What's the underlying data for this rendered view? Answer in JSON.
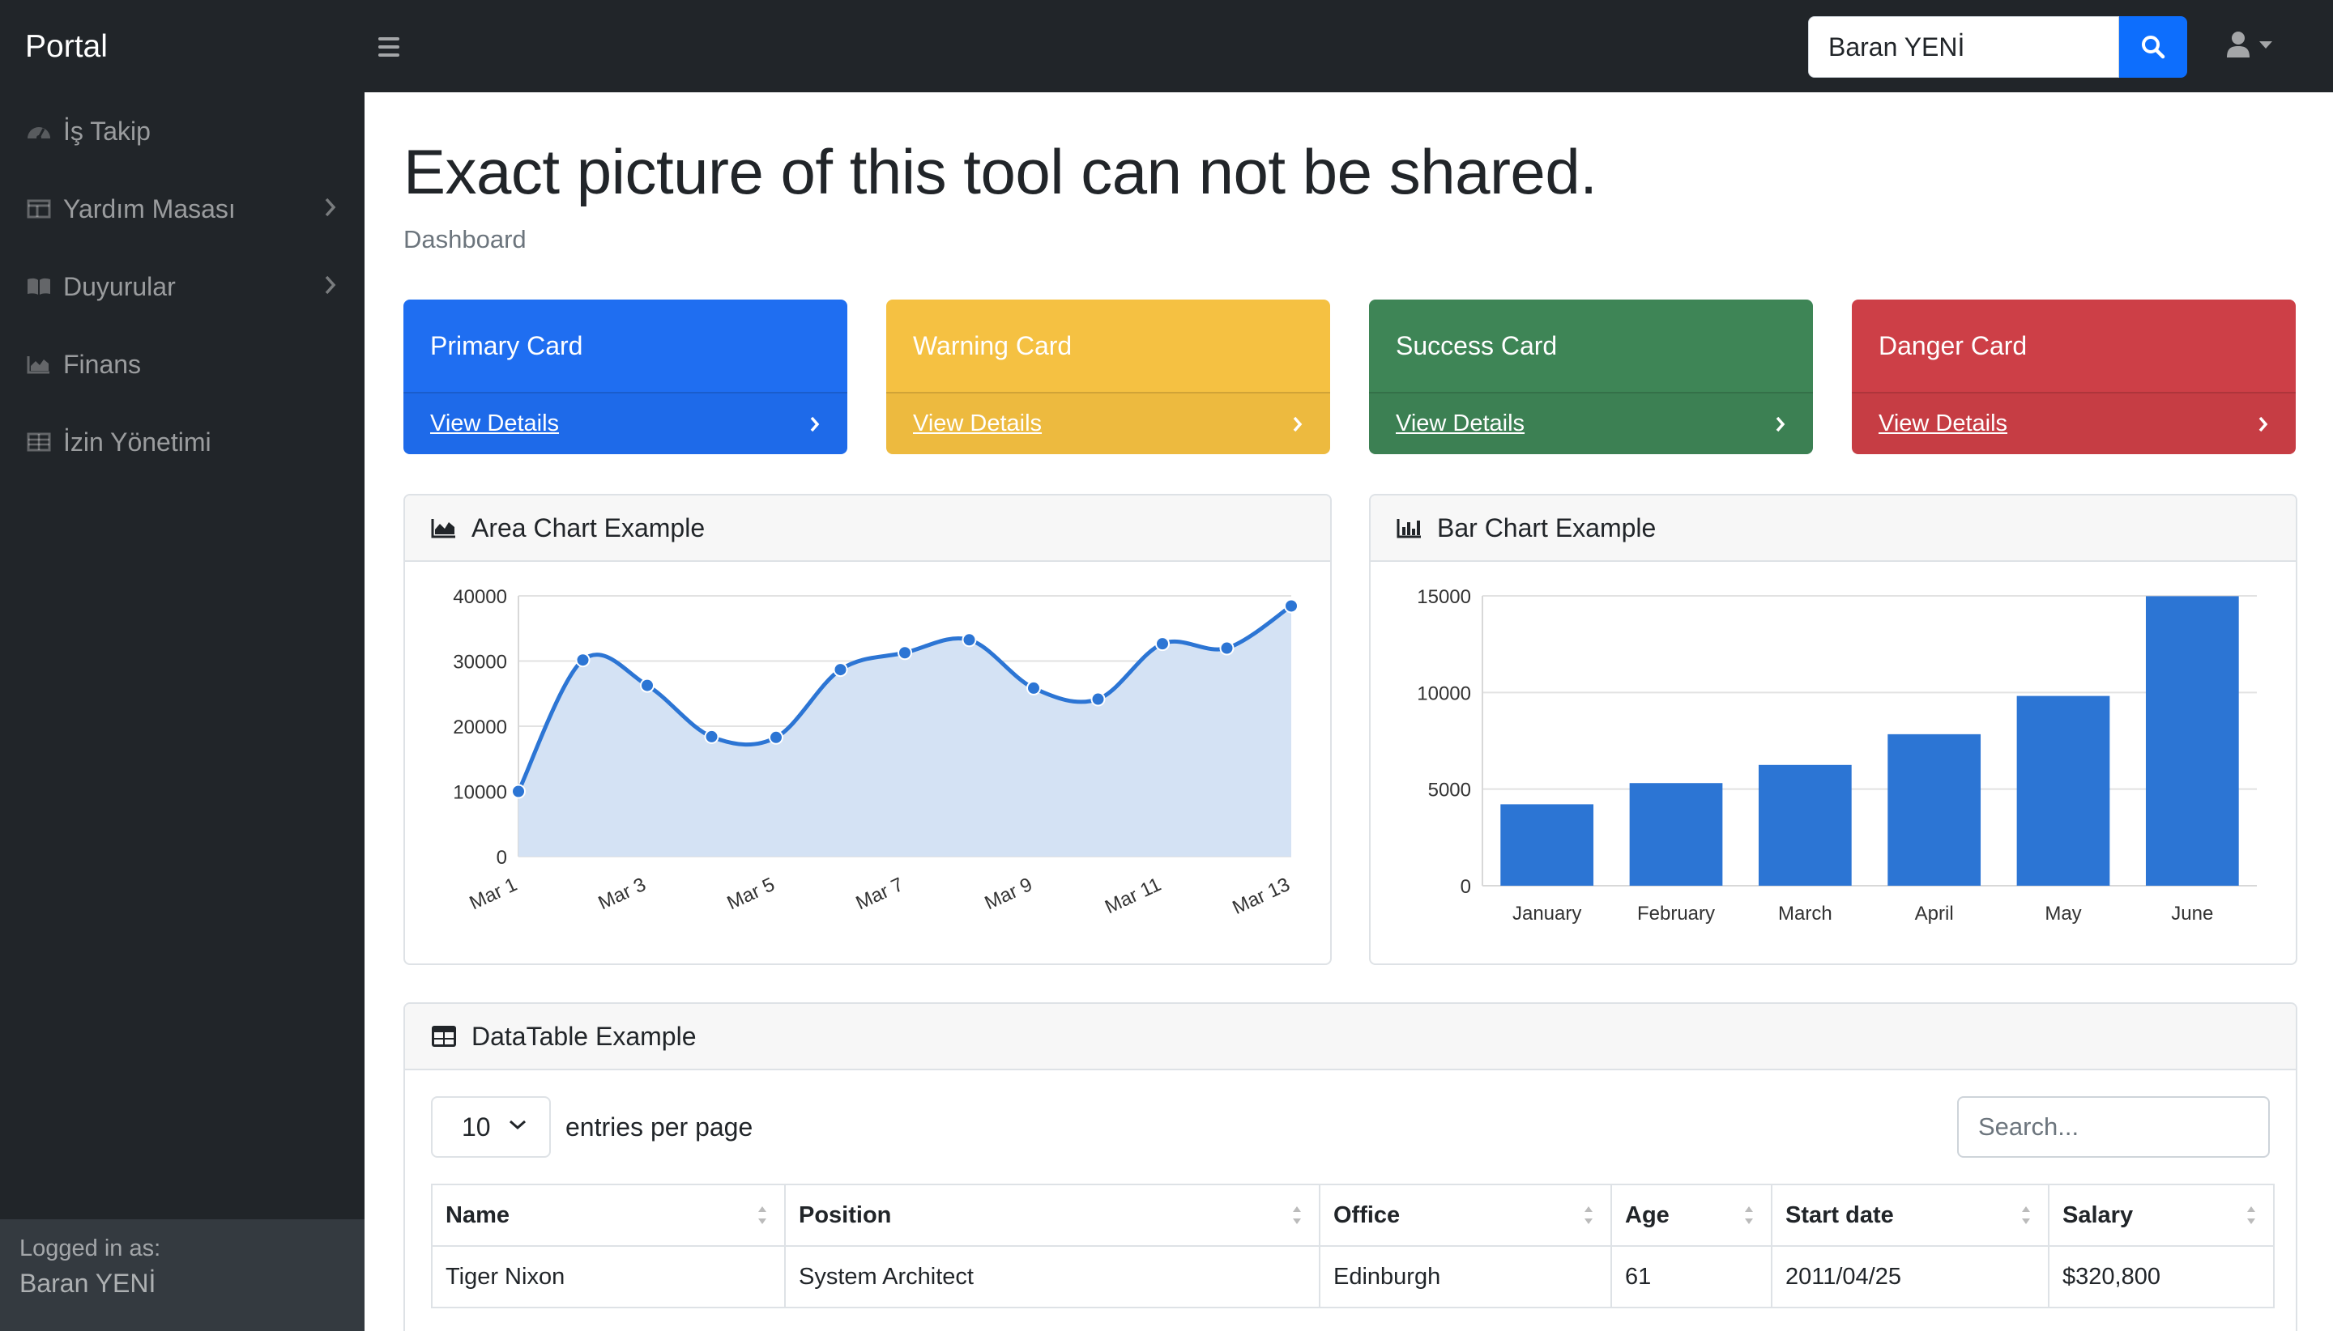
{
  "app": {
    "brand": "Portal"
  },
  "topbar": {
    "search_value": "Baran YENİ"
  },
  "sidebar": {
    "items": [
      {
        "label": "İş Takip",
        "icon": "gauge-icon",
        "has_chevron": false
      },
      {
        "label": "Yardım Masası",
        "icon": "columns-icon",
        "has_chevron": true
      },
      {
        "label": "Duyurular",
        "icon": "book-open-icon",
        "has_chevron": true
      },
      {
        "label": "Finans",
        "icon": "chart-area-icon",
        "has_chevron": false
      },
      {
        "label": "İzin Yönetimi",
        "icon": "table-icon",
        "has_chevron": false
      }
    ],
    "footer": {
      "logged_in_label": "Logged in as:",
      "user_name": "Baran YENİ"
    }
  },
  "main": {
    "title": "Exact picture of this tool can not be shared.",
    "breadcrumb": "Dashboard",
    "cards": [
      {
        "title": "Primary Card",
        "link": "View Details",
        "color": "#1f6ef1"
      },
      {
        "title": "Warning Card",
        "link": "View Details",
        "color": "#f5c142"
      },
      {
        "title": "Success Card",
        "link": "View Details",
        "color": "#3e8556"
      },
      {
        "title": "Danger Card",
        "link": "View Details",
        "color": "#cd3f47"
      }
    ],
    "area_panel_title": "Area Chart Example",
    "bar_panel_title": "Bar Chart Example",
    "table_panel_title": "DataTable Example"
  },
  "chart_data": [
    {
      "type": "area",
      "categories": [
        "Mar 1",
        "Mar 2",
        "Mar 3",
        "Mar 4",
        "Mar 5",
        "Mar 6",
        "Mar 7",
        "Mar 8",
        "Mar 9",
        "Mar 10",
        "Mar 11",
        "Mar 12",
        "Mar 13"
      ],
      "tick_labels": [
        "Mar 1",
        "Mar 3",
        "Mar 5",
        "Mar 7",
        "Mar 9",
        "Mar 11",
        "Mar 13"
      ],
      "values": [
        10000,
        30162,
        26263,
        18394,
        18287,
        28682,
        31274,
        33259,
        25849,
        24159,
        32651,
        31984,
        38451
      ],
      "ylim": [
        0,
        40000
      ],
      "yticks": [
        0,
        10000,
        20000,
        30000,
        40000
      ],
      "grid": true,
      "color": "#2c75d4",
      "fill": "#d4e2f4"
    },
    {
      "type": "bar",
      "categories": [
        "January",
        "February",
        "March",
        "April",
        "May",
        "June"
      ],
      "values": [
        4215,
        5312,
        6251,
        7841,
        9821,
        14984
      ],
      "ylim": [
        0,
        15000
      ],
      "yticks": [
        0,
        5000,
        10000,
        15000
      ],
      "grid": true,
      "color": "#2c75d4"
    }
  ],
  "datatable": {
    "page_size": "10",
    "page_size_label": "entries per page",
    "search_placeholder": "Search...",
    "columns": [
      "Name",
      "Position",
      "Office",
      "Age",
      "Start date",
      "Salary"
    ],
    "rows": [
      [
        "Tiger Nixon",
        "System Architect",
        "Edinburgh",
        "61",
        "2011/04/25",
        "$320,800"
      ]
    ]
  },
  "colors": {
    "accent": "#0d6efd",
    "nav_bg": "#212529"
  }
}
